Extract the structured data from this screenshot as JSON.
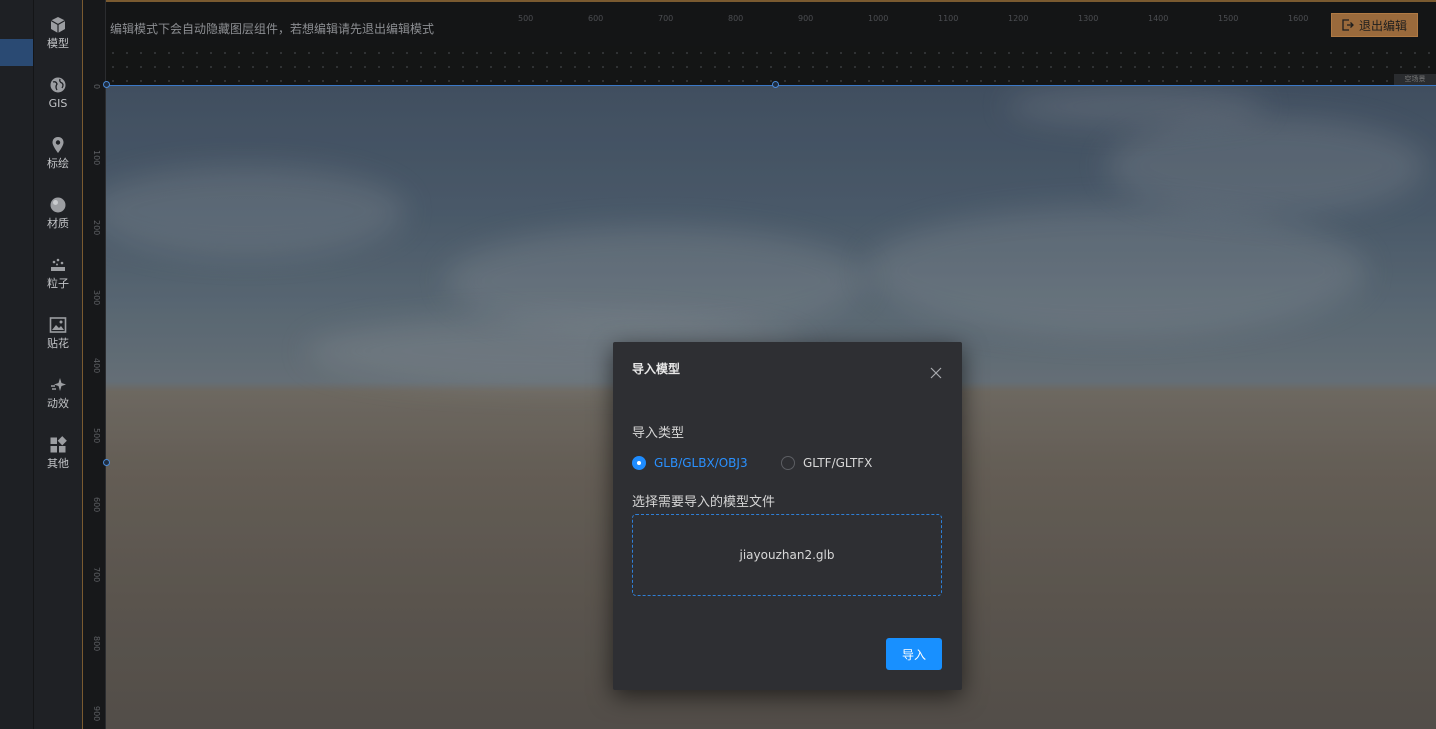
{
  "sidebar": {
    "items": [
      {
        "label": "模型",
        "icon": "cube-icon"
      },
      {
        "label": "GIS",
        "icon": "globe-icon"
      },
      {
        "label": "标绘",
        "icon": "map-pin-icon"
      },
      {
        "label": "材质",
        "icon": "sphere-icon"
      },
      {
        "label": "粒子",
        "icon": "particle-icon"
      },
      {
        "label": "贴花",
        "icon": "image-icon"
      },
      {
        "label": "动效",
        "icon": "sparkle-icon"
      },
      {
        "label": "其他",
        "icon": "grid-icon"
      }
    ]
  },
  "topbar": {
    "hint": "编辑模式下会自动隐藏图层组件，若想编辑请先退出编辑模式",
    "exit_button": "退出编辑",
    "ruler_labels": [
      "500",
      "600",
      "700",
      "800",
      "900",
      "1000",
      "1100",
      "1200",
      "1300",
      "1400",
      "1500",
      "1600",
      "1700"
    ]
  },
  "vertical_ruler": {
    "labels": [
      "0",
      "100",
      "200",
      "300",
      "400",
      "500",
      "600",
      "700",
      "800",
      "900"
    ]
  },
  "corner_tag": "空场景",
  "dialog": {
    "title": "导入模型",
    "type_label": "导入类型",
    "options": [
      {
        "label": "GLB/GLBX/OBJ3",
        "checked": true
      },
      {
        "label": "GLTF/GLTFX",
        "checked": false
      }
    ],
    "file_label": "选择需要导入的模型文件",
    "file_name": "jiayouzhan2.glb",
    "import_button": "导入"
  },
  "colors": {
    "accent": "#1890ff",
    "exit_button": "#9a6a3c",
    "dialog_bg": "#2e2f33"
  }
}
